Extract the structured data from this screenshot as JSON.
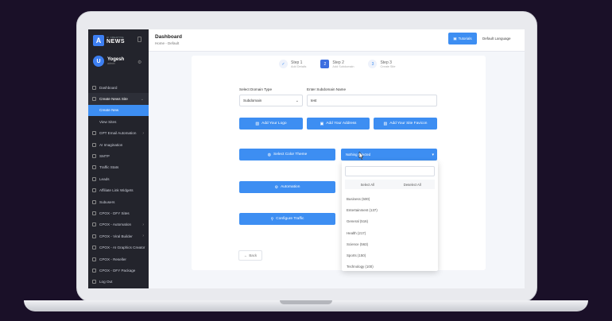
{
  "brand": {
    "small_text": "AI CREATIVE",
    "name": "NEWS"
  },
  "user": {
    "name": "Yogesh",
    "role": "admin",
    "avatar_letter": "U"
  },
  "sidebar": {
    "items": [
      {
        "label": "Dashboard",
        "has_chevron": false
      },
      {
        "label": "Create News Site",
        "has_chevron": true,
        "expanded": true
      },
      {
        "label": "Create New",
        "sub": true,
        "active": true
      },
      {
        "label": "View Sites",
        "sub": true
      },
      {
        "label": "GPT Email Automation",
        "has_chevron": true
      },
      {
        "label": "AI Imagination"
      },
      {
        "label": "SMTP"
      },
      {
        "label": "Traffic Stats"
      },
      {
        "label": "Leads"
      },
      {
        "label": "Affiliate Link Widgets"
      },
      {
        "label": "Subusers"
      },
      {
        "label": "CPOX - DFY Sites"
      },
      {
        "label": "CPOX - Automation",
        "has_chevron": true
      },
      {
        "label": "CPOX - Viral Builder",
        "has_chevron": true
      },
      {
        "label": "CPOX - AI Graphics Creator"
      },
      {
        "label": "CPOX - Reseller"
      },
      {
        "label": "CPOX - DFY Package"
      },
      {
        "label": "Log Out"
      }
    ]
  },
  "header": {
    "title": "Dashboard",
    "breadcrumb_home": "Home",
    "breadcrumb_sep": " - ",
    "breadcrumb_current": "Default",
    "tutorials_label": "Tutorials",
    "language_label": "Default Language"
  },
  "steps": [
    {
      "number": "✓",
      "title": "Step 1",
      "subtitle": "Add Details",
      "active": false
    },
    {
      "number": "2",
      "title": "Step 2",
      "subtitle": "Add Subdomain",
      "active": true
    },
    {
      "number": "3",
      "title": "Step 3",
      "subtitle": "Create Site",
      "active": false
    }
  ],
  "form": {
    "domain_type_label": "Select Domain Type",
    "domain_type_value": "Subdomain",
    "subdomain_label": "Enter Subdomain Name",
    "subdomain_value": "test",
    "add_logo_label": "Add Your Logo",
    "add_address_label": "Add Your Address",
    "add_favicon_label": "Add Your Site Favicon",
    "select_color_label": "Select Color Theme",
    "automation_label": "Automation",
    "configure_traffic_label": "Configure Traffic",
    "back_label": "Back"
  },
  "category_dropdown": {
    "placeholder": "Nothing selected",
    "select_all": "Select All",
    "deselect_all": "Deselect All",
    "options": [
      "Business (500)",
      "Entertainment (137)",
      "General (516)",
      "Health (217)",
      "Science (563)",
      "Sports (150)",
      "Technology (100)"
    ]
  },
  "colors": {
    "accent": "#3d8ef2",
    "sidebar_bg": "#23242c"
  }
}
